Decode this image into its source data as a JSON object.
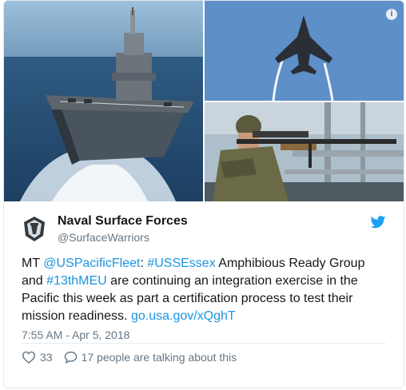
{
  "media": {
    "photos": [
      {
        "description": "amphibious-assault-ship-photo"
      },
      {
        "description": "f35-jet-photo"
      },
      {
        "description": "marine-sniper-photo"
      }
    ],
    "info_icon": "i"
  },
  "author": {
    "name": "Naval Surface Forces",
    "handle": "@SurfaceWarriors"
  },
  "tweet": {
    "segments": [
      {
        "text": "MT ",
        "link": false
      },
      {
        "text": "@USPacificFleet",
        "link": true
      },
      {
        "text": ": ",
        "link": false
      },
      {
        "text": "#USSEssex",
        "link": true
      },
      {
        "text": " Amphibious Ready Group and ",
        "link": false
      },
      {
        "text": "#13thMEU",
        "link": true
      },
      {
        "text": " are continuing an integration exercise in the Pacific this week as part a certification process to test their mission readiness. ",
        "link": false
      },
      {
        "text": "go.usa.gov/xQghT",
        "link": true
      }
    ],
    "timestamp": "7:55 AM - Apr 5, 2018",
    "likes": "33",
    "talking": "17 people are talking about this"
  },
  "colors": {
    "link": "#1b95e0",
    "muted": "#657786",
    "twitter_blue": "#1da1f2"
  }
}
